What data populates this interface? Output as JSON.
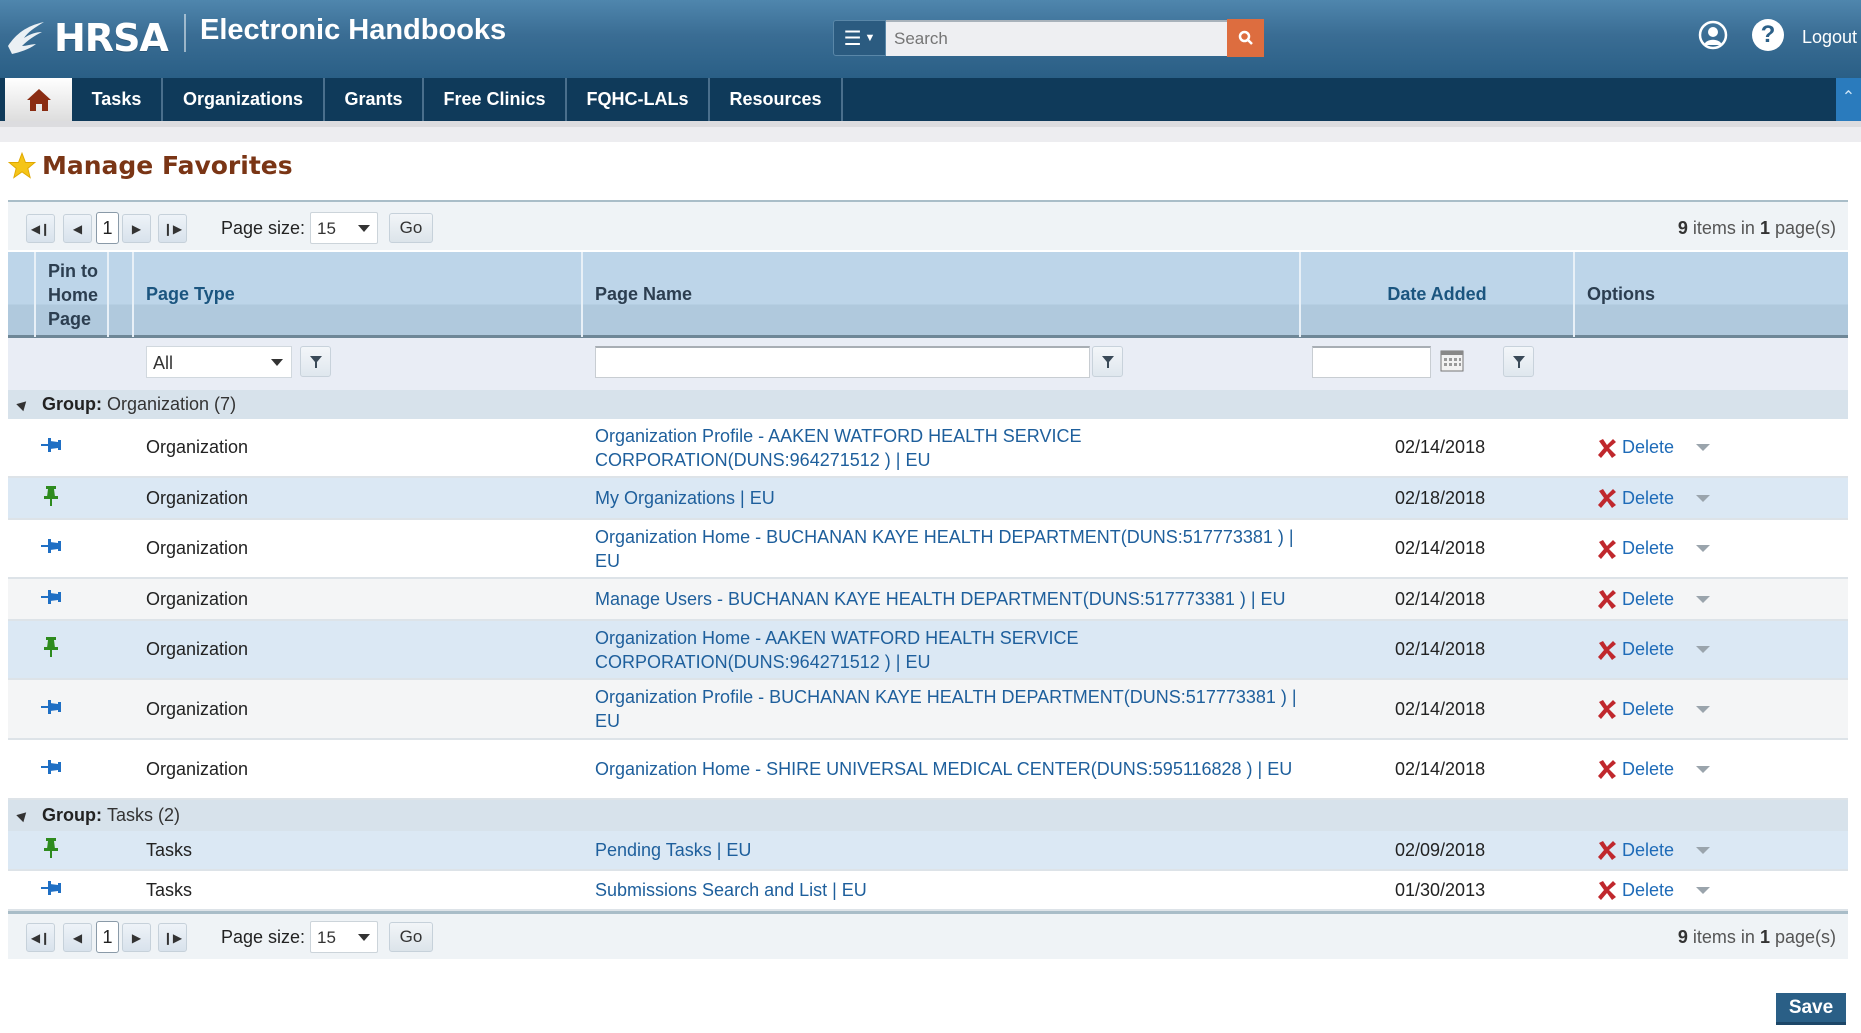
{
  "header": {
    "logo_text": "HRSA",
    "app_title": "Electronic Handbooks",
    "search_placeholder": "Search",
    "logout_label": "Logout",
    "icons": {
      "menu": "hamburger-menu-icon",
      "search": "search-icon",
      "user": "user-profile-icon",
      "help": "help-icon"
    }
  },
  "nav": {
    "home_icon": "home-icon",
    "tabs": [
      {
        "label": "Tasks"
      },
      {
        "label": "Organizations"
      },
      {
        "label": "Grants"
      },
      {
        "label": "Free Clinics"
      },
      {
        "label": "FQHC-LALs"
      },
      {
        "label": "Resources"
      }
    ],
    "collapse_icon": "double-chevron-up-icon"
  },
  "page": {
    "title": "Manage Favorites",
    "title_icon": "star-icon"
  },
  "pager": {
    "current_page": "1",
    "page_size_label": "Page size:",
    "page_size_value": "15",
    "go_label": "Go",
    "items_count": "9",
    "items_text": "items in",
    "pages_count": "1",
    "pages_text": "page(s)"
  },
  "columns": {
    "pin": "Pin to Home Page",
    "page_type": "Page Type",
    "page_name": "Page Name",
    "date_added": "Date Added",
    "options": "Options"
  },
  "filters": {
    "page_type_value": "All",
    "page_name_value": "",
    "date_value": ""
  },
  "groups": [
    {
      "label": "Group:",
      "name": "Organization (7)",
      "rows": [
        {
          "pinned": false,
          "page_type": "Organization",
          "page_name": "Organization Profile - AAKEN WATFORD HEALTH SERVICE CORPORATION(DUNS:964271512 ) | EU",
          "date": "02/14/2018",
          "action": "Delete"
        },
        {
          "pinned": true,
          "page_type": "Organization",
          "page_name": "My Organizations | EU",
          "date": "02/18/2018",
          "action": "Delete"
        },
        {
          "pinned": false,
          "page_type": "Organization",
          "page_name": "Organization Home - BUCHANAN KAYE HEALTH DEPARTMENT(DUNS:517773381 ) | EU",
          "date": "02/14/2018",
          "action": "Delete"
        },
        {
          "pinned": false,
          "page_type": "Organization",
          "page_name": "Manage Users - BUCHANAN KAYE HEALTH DEPARTMENT(DUNS:517773381 ) | EU",
          "date": "02/14/2018",
          "action": "Delete"
        },
        {
          "pinned": true,
          "page_type": "Organization",
          "page_name": "Organization Home - AAKEN WATFORD HEALTH SERVICE CORPORATION(DUNS:964271512 ) | EU",
          "date": "02/14/2018",
          "action": "Delete"
        },
        {
          "pinned": false,
          "page_type": "Organization",
          "page_name": "Organization Profile - BUCHANAN KAYE HEALTH DEPARTMENT(DUNS:517773381 ) | EU",
          "date": "02/14/2018",
          "action": "Delete"
        },
        {
          "pinned": false,
          "page_type": "Organization",
          "page_name": "Organization Home - SHIRE UNIVERSAL MEDICAL CENTER(DUNS:595116828 ) | EU",
          "date": "02/14/2018",
          "action": "Delete"
        }
      ]
    },
    {
      "label": "Group:",
      "name": "Tasks (2)",
      "rows": [
        {
          "pinned": true,
          "page_type": "Tasks",
          "page_name": "Pending Tasks | EU",
          "date": "02/09/2018",
          "action": "Delete"
        },
        {
          "pinned": false,
          "page_type": "Tasks",
          "page_name": "Submissions Search and List | EU",
          "date": "01/30/2013",
          "action": "Delete"
        }
      ]
    }
  ],
  "save_label": "Save",
  "colors": {
    "header_blue": "#2a5f86",
    "nav_navy": "#0f3a5a",
    "search_orange": "#dd6d3f",
    "title_brown": "#7a3515",
    "link_blue": "#1e5f9c",
    "pin_green": "#2e8b1e",
    "pin_blue": "#1f6fc4",
    "delete_red": "#c0282d"
  }
}
